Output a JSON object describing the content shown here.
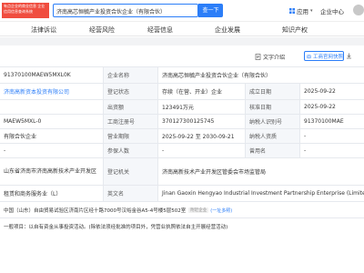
{
  "topbar": {
    "brand_text": "有点企业的商业信息 企业信用信息查询系统",
    "search_value": "济南高芯恒毓产业投资合伙企业（有限合伙）",
    "search_button": "查一下",
    "app_menu": "应用",
    "user_center": "企业中心"
  },
  "tabs": [
    "法律诉讼",
    "经营风险",
    "经营信息",
    "企业发展",
    "知识产权"
  ],
  "toolbar": {
    "text_intro": "文字介绍",
    "official_site": "工商官网快照",
    "download": "导出"
  },
  "info": {
    "credit_code": "91370100MAEW5MXL0K",
    "company_name_label": "企业名称",
    "company_name": "济南高芯恒毓产业投资合伙企业（有限合伙）",
    "partner_link": "济南高新资本投资有限公司",
    "reg_status_label": "登记状态",
    "reg_status": "存续（在营、开业）企业",
    "setup_date_label": "成立日期",
    "setup_date": "2025-09-22",
    "capital_label": "出资额",
    "capital": "123491万元",
    "approve_label": "核准日期",
    "approve_date": "2025-09-22",
    "reg_no_partial": "MAEW5MXL-0",
    "org_code_label": "工商注册号",
    "org_code": "370127300125745",
    "taxpayer_label": "纳税人识别号",
    "taxpayer_id": "91370100MAE",
    "company_type": "有限合伙企业",
    "term_label": "营业期限",
    "term": "2025-09-22 至 2030-09-21",
    "taxpayer_qual_label": "纳税人资质",
    "taxpayer_qual": "-",
    "dash1": "-",
    "insured_label": "参保人数",
    "insured": "-",
    "former_name_label": "曾用名",
    "former_name": "-",
    "region": "山东省济南市济南高新技术产业开发区",
    "authority_label": "登记机关",
    "authority": "济南高新技术产业开发区管委会市场监管局",
    "industry": "租赁和商务服务业（L）",
    "en_name_label": "英文名",
    "en_name": "Jinan Gaoxin Hengyao Industrial Investment Partnership Enterprise (Limited Partnership)",
    "address": "中国（山东）自由贸易试验区济南片区经十路7000号汉峪金谷A5-4号楼5层502室",
    "address_tag": "附近企业",
    "address_more": "(一址多照)",
    "scope": "一般项目：以自有资金从事投资活动。(除依法须经批准的项目外，凭营业执照依法自主开展经营活动)"
  },
  "colors": {
    "accent": "#2c7ef8",
    "brand_red": "#f04d3f",
    "label_bg": "#f5f7fa"
  }
}
